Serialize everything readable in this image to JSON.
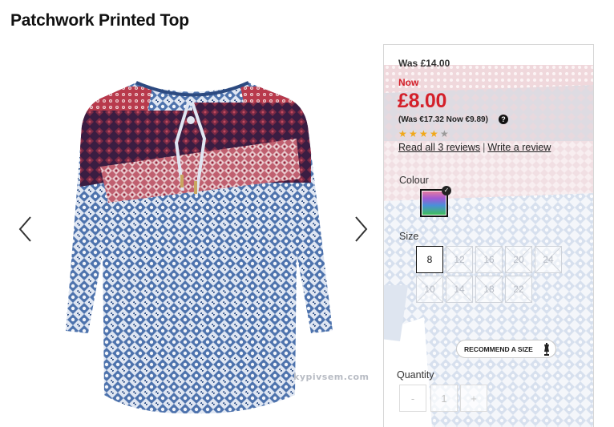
{
  "page": {
    "title": "Patchwork Printed Top",
    "watermark": "kypivsem.com"
  },
  "price": {
    "was": "Was £14.00",
    "now_label": "Now",
    "now_price": "£8.00",
    "euro_line": "(Was €17.32 Now €9.89)"
  },
  "reviews": {
    "rating": 4,
    "max": 5,
    "read_all": "Read all 3 reviews",
    "separator": "|",
    "write": "Write a review"
  },
  "colour": {
    "label": "Colour"
  },
  "size": {
    "label": "Size",
    "options": [
      {
        "value": "8",
        "available": true
      },
      {
        "value": "12",
        "available": false
      },
      {
        "value": "16",
        "available": false
      },
      {
        "value": "20",
        "available": false
      },
      {
        "value": "24",
        "available": false
      },
      {
        "value": "10",
        "available": false
      },
      {
        "value": "14",
        "available": false
      },
      {
        "value": "18",
        "available": false
      },
      {
        "value": "22",
        "available": false
      }
    ]
  },
  "recommend": {
    "label": "RECOMMEND A SIZE"
  },
  "quantity": {
    "label": "Quantity",
    "minus": "-",
    "value": "1",
    "plus": "+"
  },
  "icons": {
    "prev": "chevron-left-icon",
    "next": "chevron-right-icon",
    "help": "question-circle-icon",
    "check": "check-badge-icon",
    "mannequin": "mannequin-icon"
  },
  "colors": {
    "price_red": "#d4202a",
    "star_gold": "#f1a818",
    "print_blue": "#5b7fb5",
    "print_red": "#a8324a",
    "print_navy": "#3a1e45"
  }
}
